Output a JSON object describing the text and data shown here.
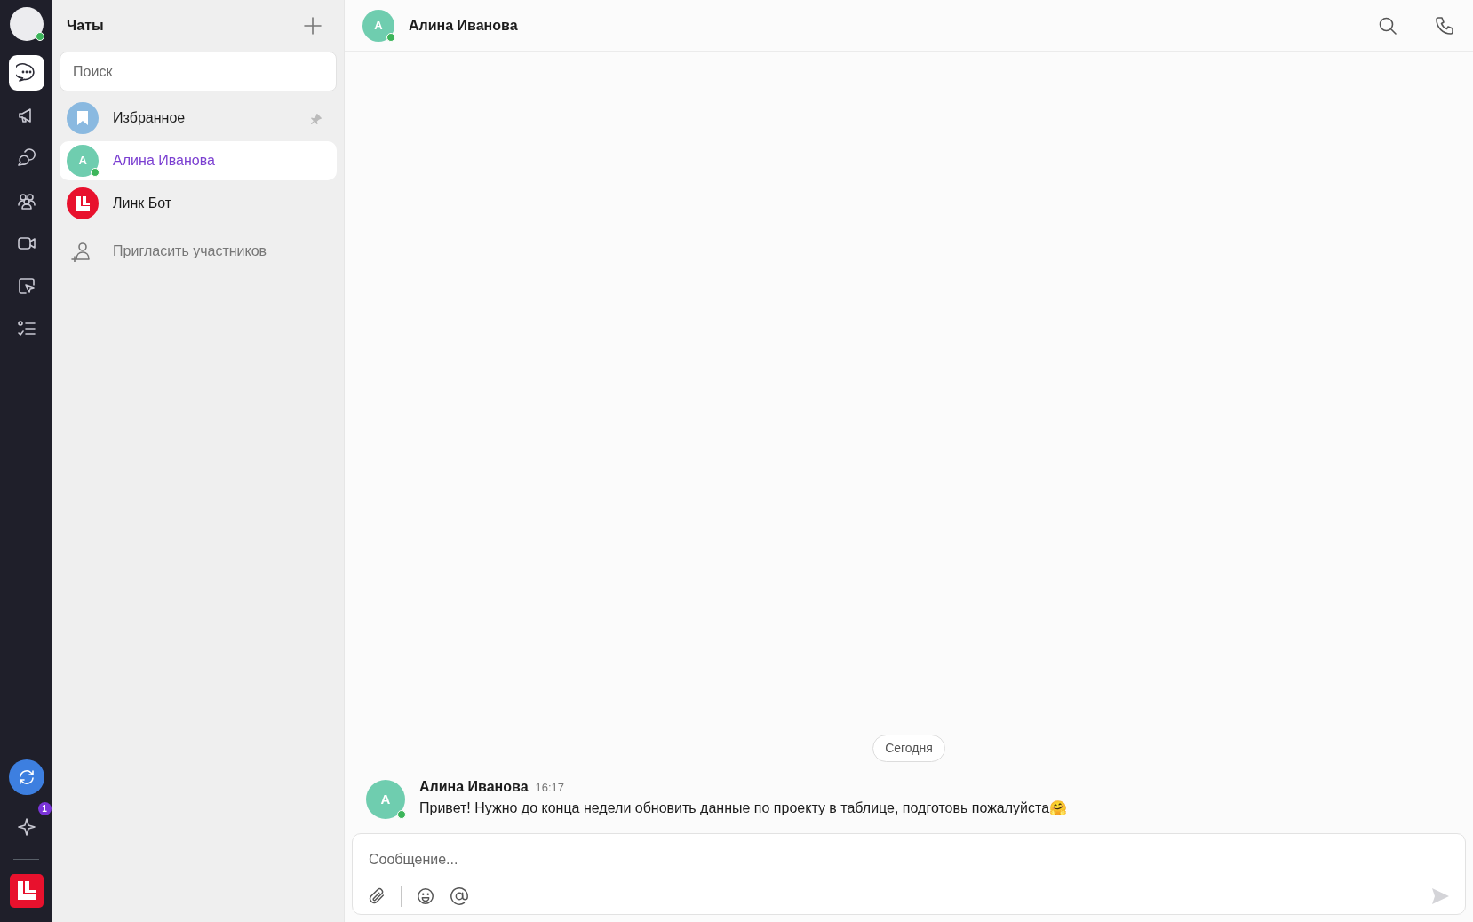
{
  "rail": {
    "profile": {
      "online": true
    },
    "items": [
      {
        "kind": "chats",
        "selected": true
      },
      {
        "kind": "megaphone",
        "selected": false
      },
      {
        "kind": "threads",
        "selected": false
      },
      {
        "kind": "people",
        "selected": false
      },
      {
        "kind": "video",
        "selected": false
      },
      {
        "kind": "board",
        "selected": false
      },
      {
        "kind": "tasks",
        "selected": false
      }
    ],
    "ai_badge": "1"
  },
  "chat_list": {
    "title": "Чаты",
    "search": {
      "placeholder": "Поиск"
    },
    "chats": [
      {
        "kind": "favorites",
        "name": "Избранное",
        "pinned": true,
        "online": false,
        "selected": false
      },
      {
        "kind": "person",
        "name": "Алина Иванова",
        "initial": "А",
        "pinned": false,
        "online": true,
        "selected": true
      },
      {
        "kind": "bot",
        "name": "Линк Бот",
        "pinned": false,
        "online": false,
        "selected": false
      }
    ],
    "invite": "Пригласить участников"
  },
  "conversation": {
    "header": {
      "name": "Алина Иванова",
      "initial": "А",
      "online": true
    },
    "date_label": "Сегодня",
    "messages": [
      {
        "author": "Алина Иванова",
        "initial": "А",
        "online": true,
        "time": "16:17",
        "text": "Привет! Нужно до конца недели обновить данные по проекту в таблице, подготовь пожалуйста🤗"
      }
    ],
    "composer": {
      "placeholder": "Сообщение..."
    }
  }
}
